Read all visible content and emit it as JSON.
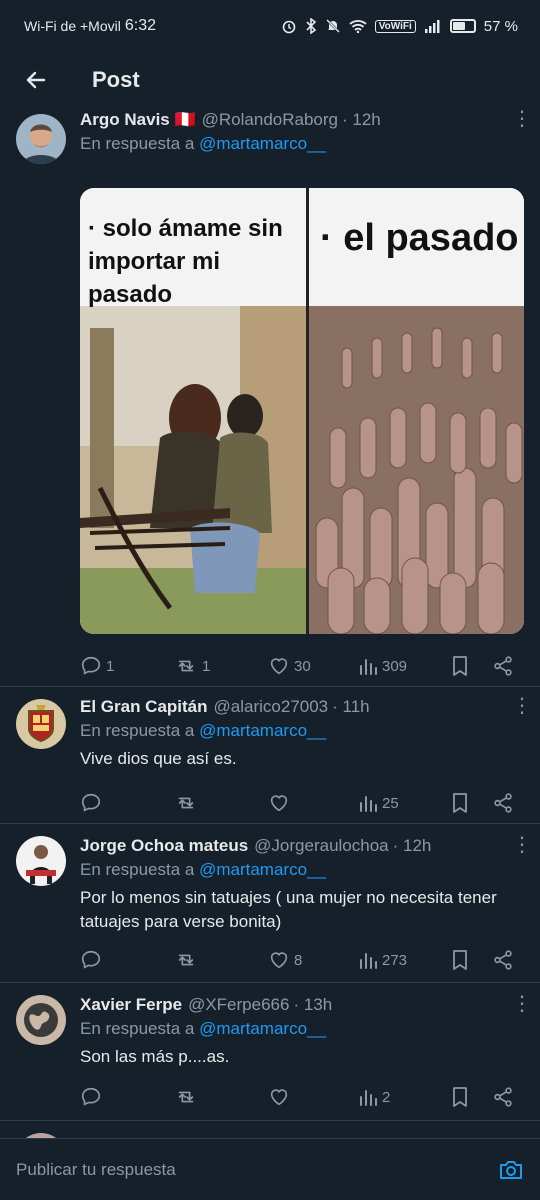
{
  "status_bar": {
    "carrier": "Wi-Fi de +Movil",
    "time": "6:32",
    "volte": "VoWiFi",
    "battery": "57 %"
  },
  "header": {
    "title": "Post"
  },
  "tweets": [
    {
      "name": "Argo Navis 🇵🇪",
      "handle": "@RolandoRaborg",
      "time": "· 12h",
      "reply_label": "En respuesta a",
      "reply_mention": "@martamarco__",
      "text": "",
      "image": {
        "left_caption": "· solo ámame sin importar mi pasado",
        "right_caption": "· el pasado"
      },
      "replies": "1",
      "retweets": "1",
      "likes": "30",
      "views": "309"
    },
    {
      "name": "El Gran Capitán",
      "handle": "@alarico27003",
      "time": "· 11h",
      "reply_label": "En respuesta a",
      "reply_mention": "@martamarco__",
      "text": "Vive dios que así es.",
      "replies": "",
      "retweets": "",
      "likes": "",
      "views": "25"
    },
    {
      "name": "Jorge Ochoa mateus",
      "handle": "@Jorgeraulochoa",
      "time": "· 12h",
      "reply_label": "En respuesta a",
      "reply_mention": "@martamarco__",
      "text": "Por lo menos sin tatuajes ( una mujer no necesita tener tatuajes para verse bonita)",
      "replies": "",
      "retweets": "",
      "likes": "8",
      "views": "273"
    },
    {
      "name": "Xavier Ferpe",
      "handle": "@XFerpe666",
      "time": "· 13h",
      "reply_label": "En respuesta a",
      "reply_mention": "@martamarco__",
      "text": "Son las más p....as.",
      "replies": "",
      "retweets": "",
      "likes": "",
      "views": "2"
    }
  ],
  "composer": {
    "placeholder": "Publicar tu respuesta"
  },
  "colors": {
    "background": "#15202b",
    "accent": "#1d9bf0",
    "muted": "#8b98a5",
    "divider": "#2f3b47"
  }
}
